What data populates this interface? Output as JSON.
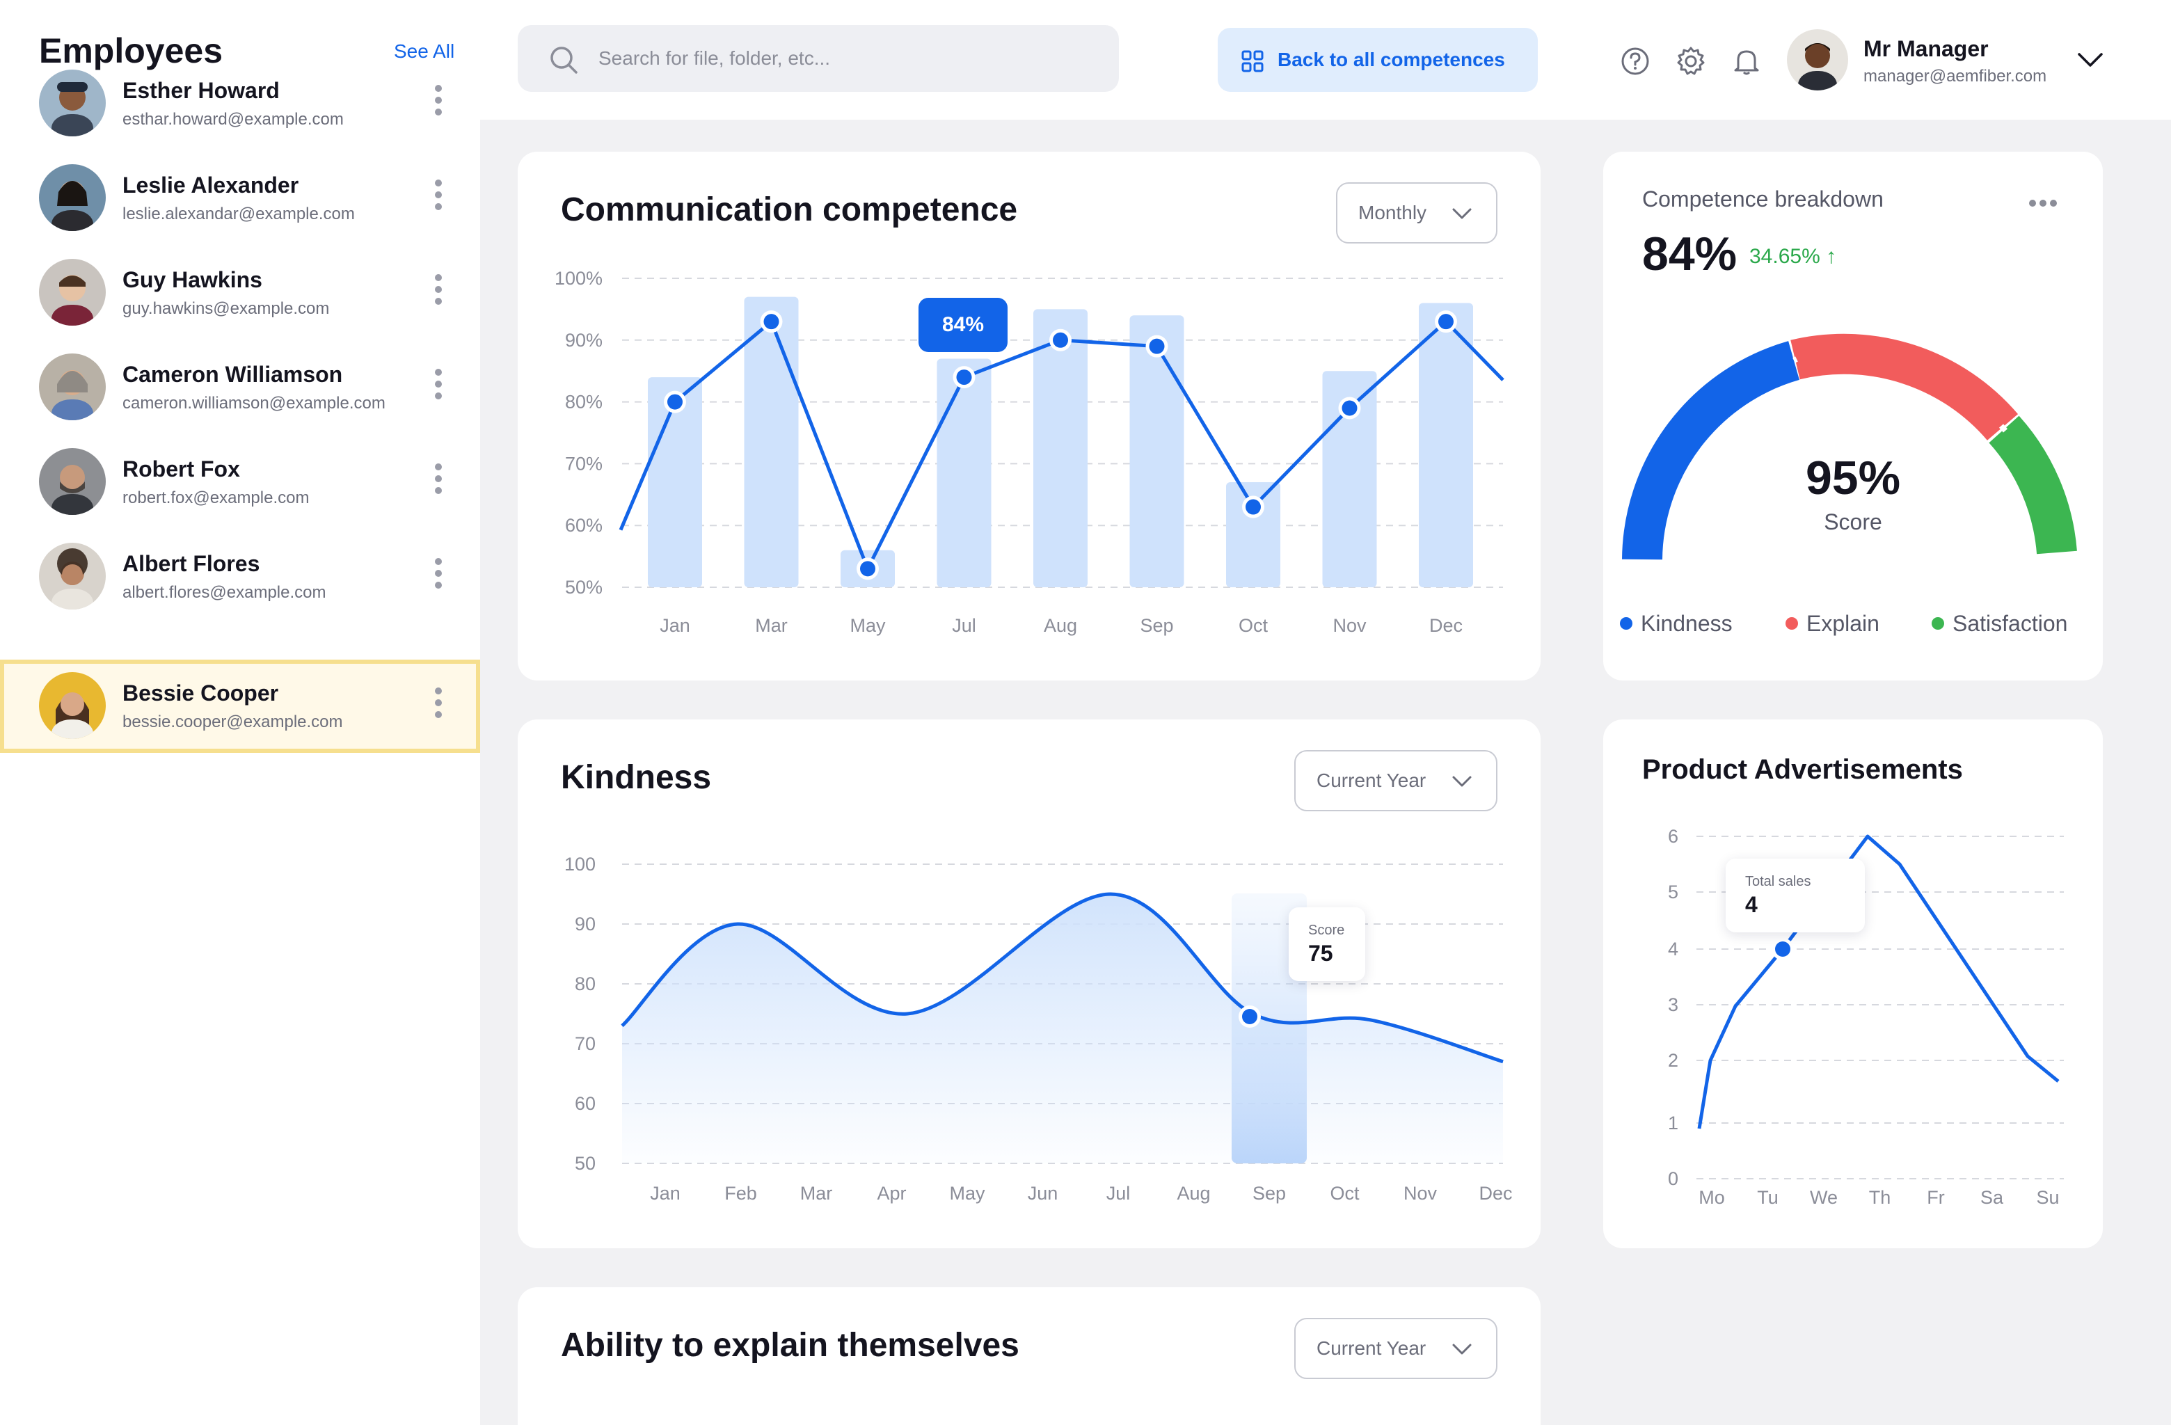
{
  "sidebar": {
    "title": "Employees",
    "see_all": "See All",
    "employees": [
      {
        "name": "Esther Howard",
        "email": "esthar.howard@example.com",
        "selected": false
      },
      {
        "name": "Leslie Alexander",
        "email": "leslie.alexandar@example.com",
        "selected": false
      },
      {
        "name": "Guy Hawkins",
        "email": "guy.hawkins@example.com",
        "selected": false
      },
      {
        "name": "Cameron Williamson",
        "email": "cameron.williamson@example.com",
        "selected": false
      },
      {
        "name": "Robert Fox",
        "email": "robert.fox@example.com",
        "selected": false
      },
      {
        "name": "Albert Flores",
        "email": "albert.flores@example.com",
        "selected": false
      },
      {
        "name": "Bessie Cooper",
        "email": "bessie.cooper@example.com",
        "selected": true
      }
    ]
  },
  "header": {
    "search_placeholder": "Search for file, folder, etc...",
    "back_button": "Back to all competences",
    "manager_name": "Mr Manager",
    "manager_email": "manager@aemfiber.com",
    "icons": [
      "help-icon",
      "settings-icon",
      "bell-icon",
      "chevron-down-icon"
    ]
  },
  "communication": {
    "title": "Communication competence",
    "dropdown": "Monthly",
    "tooltip": "84%"
  },
  "breakdown": {
    "label": "Competence breakdown",
    "value": "84%",
    "change": "34.65% ↑",
    "score": "95%",
    "score_label": "Score",
    "legend": [
      {
        "name": "Kindness",
        "color": "#1264e8"
      },
      {
        "name": "Explain",
        "color": "#f25c5c"
      },
      {
        "name": "Satisfaction",
        "color": "#3cb651"
      }
    ]
  },
  "kindness": {
    "title": "Kindness",
    "dropdown": "Current Year",
    "tooltip_label": "Score",
    "tooltip_value": "75"
  },
  "ads": {
    "title": "Product Advertisements",
    "tooltip_label": "Total sales",
    "tooltip_value": "4"
  },
  "explain": {
    "title": "Ability to explain themselves",
    "dropdown": "Current Year"
  },
  "chart_data": [
    {
      "id": "communication",
      "type": "bar",
      "title": "Communication competence",
      "categories": [
        "Jan",
        "Mar",
        "May",
        "Jul",
        "Aug",
        "Sep",
        "Oct",
        "Nov",
        "Dec"
      ],
      "yticks": [
        "100%",
        "90%",
        "80%",
        "70%",
        "60%",
        "50%"
      ],
      "ylim": [
        50,
        100
      ],
      "bars": [
        84,
        97,
        56,
        87,
        95,
        94,
        67,
        85,
        96
      ],
      "line": [
        80,
        93,
        53,
        84,
        90,
        89,
        63,
        79,
        93
      ],
      "highlight": {
        "category": "Jul",
        "label": "84%"
      },
      "colors": {
        "bar": "#cfe2fc",
        "line": "#1264e8"
      }
    },
    {
      "id": "kindness",
      "type": "area",
      "title": "Kindness",
      "categories": [
        "Jan",
        "Feb",
        "Mar",
        "Apr",
        "May",
        "Jun",
        "Jul",
        "Aug",
        "Sep",
        "Oct",
        "Nov",
        "Dec"
      ],
      "yticks": [
        "100",
        "90",
        "80",
        "70",
        "60",
        "50"
      ],
      "ylim": [
        50,
        100
      ],
      "values": [
        83,
        89,
        84,
        76,
        79,
        90,
        95,
        83,
        75,
        74,
        73,
        66
      ],
      "highlight": {
        "category": "Sep",
        "value": 75,
        "label": "Score"
      },
      "colors": {
        "line": "#1264e8",
        "fill": "#cfe2fc"
      }
    },
    {
      "id": "ads",
      "type": "line",
      "title": "Product Advertisements",
      "categories": [
        "Mo",
        "Tu",
        "We",
        "Th",
        "Fr",
        "Sa",
        "Su"
      ],
      "yticks": [
        "6",
        "5",
        "4",
        "3",
        "2",
        "1",
        "0"
      ],
      "ylim": [
        0,
        6
      ],
      "values": [
        1,
        3,
        4,
        6,
        4.4,
        2.6,
        1.8
      ],
      "highlight": {
        "x": 1.3,
        "value": 4,
        "label": "Total sales"
      },
      "colors": {
        "line": "#1264e8"
      }
    }
  ]
}
